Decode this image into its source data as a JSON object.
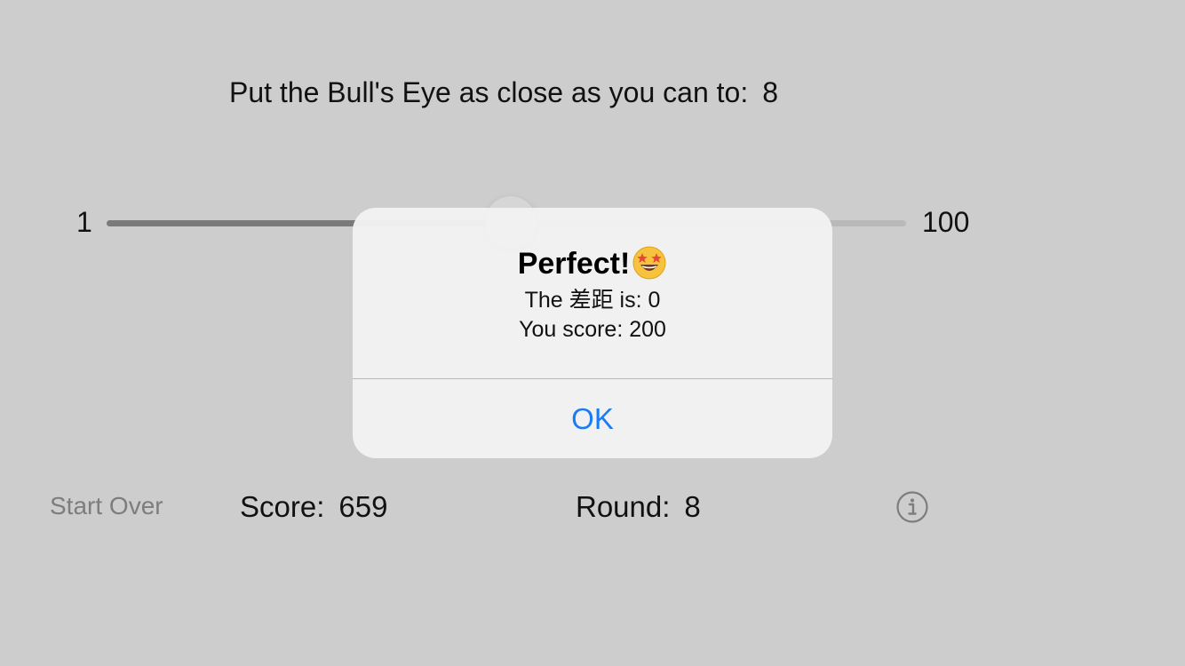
{
  "game": {
    "prompt_label": "Put the Bull's Eye as close as you can to:",
    "target_value": "8"
  },
  "slider": {
    "min_label": "1",
    "max_label": "100",
    "min": 1,
    "max": 100,
    "value": 51
  },
  "bottom_bar": {
    "start_over_label": "Start Over",
    "score_label": "Score:",
    "score_value": "659",
    "round_label": "Round:",
    "round_value": "8",
    "info_icon": "info-circle-icon"
  },
  "alert": {
    "title": "Perfect!",
    "title_emoji": "star-struck-emoji",
    "message_line1": "The 差距 is: 0",
    "message_line2": "You score: 200",
    "ok_label": "OK"
  },
  "colors": {
    "background": "#cdcdcd",
    "accent": "#1a7cf4",
    "secondary_text": "#7d7d7d"
  }
}
